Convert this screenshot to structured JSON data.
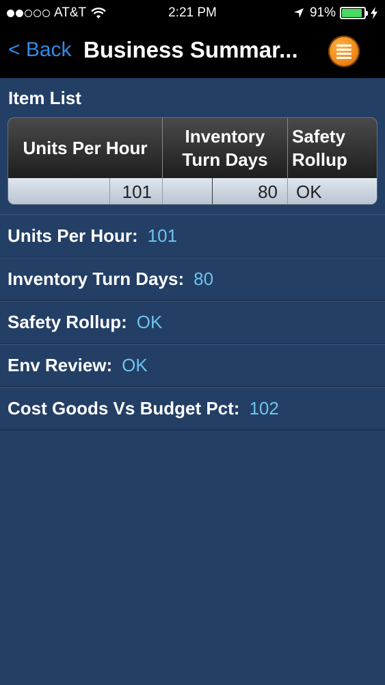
{
  "status_bar": {
    "carrier": "AT&T",
    "time": "2:21 PM",
    "battery_pct": "91%",
    "battery_level": 0.91,
    "signal_bars_filled": 2,
    "signal_bars_total": 5
  },
  "nav": {
    "back_label": "< Back",
    "title": "Business Summar..."
  },
  "item_list": {
    "title": "Item List",
    "columns": [
      "Units Per Hour",
      "Inventory Turn Days",
      "Safety Rollup"
    ],
    "column_lines": [
      [
        "Units Per Hour"
      ],
      [
        "Inventory",
        "Turn Days"
      ],
      [
        "Safety",
        "Rollup"
      ]
    ],
    "row": [
      "101",
      "80",
      "OK"
    ]
  },
  "fields": [
    {
      "label": "Units Per Hour:",
      "value": "101"
    },
    {
      "label": "Inventory Turn Days:",
      "value": "80"
    },
    {
      "label": "Safety Rollup:",
      "value": "OK"
    },
    {
      "label": "Env Review:",
      "value": "OK"
    },
    {
      "label": "Cost Goods Vs Budget Pct:",
      "value": "102"
    }
  ],
  "colors": {
    "background": "#233f66",
    "accent_blue": "#2e8be8",
    "value_blue": "#6fc3ec",
    "menu_orange": "#f08a1c"
  },
  "icons": {
    "wifi": "wifi-icon",
    "location": "location-arrow-icon",
    "battery": "battery-icon",
    "charging": "charging-bolt-icon",
    "menu": "menu-list-icon"
  }
}
